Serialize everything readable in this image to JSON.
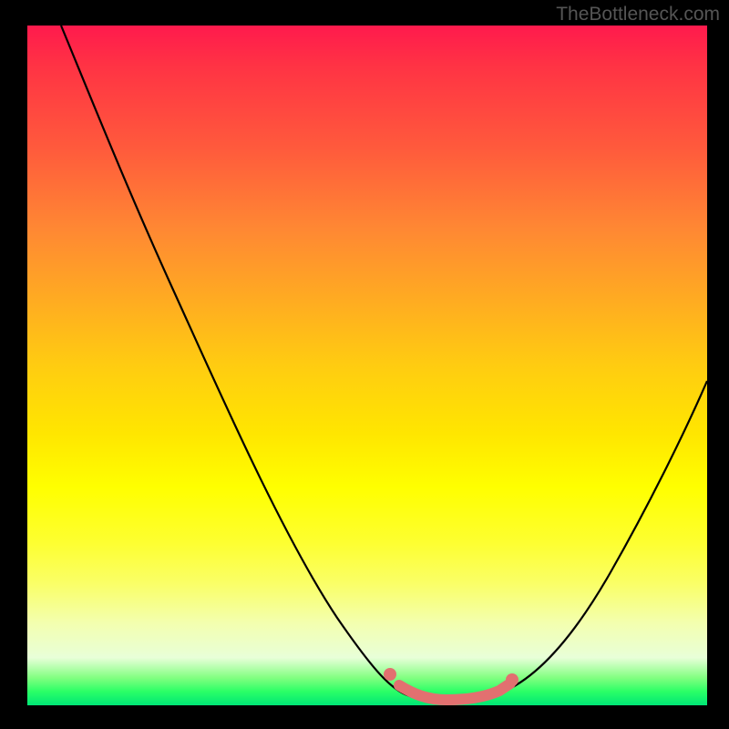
{
  "watermark": "TheBottleneck.com",
  "chart_data": {
    "type": "line",
    "title": "",
    "xlabel": "",
    "ylabel": "",
    "xlim": [
      0,
      100
    ],
    "ylim": [
      0,
      100
    ],
    "series": [
      {
        "name": "bottleneck-curve",
        "color": "#000000",
        "points": [
          {
            "x": 5,
            "y": 100
          },
          {
            "x": 12,
            "y": 84
          },
          {
            "x": 20,
            "y": 66
          },
          {
            "x": 28,
            "y": 48
          },
          {
            "x": 36,
            "y": 31
          },
          {
            "x": 44,
            "y": 16
          },
          {
            "x": 50,
            "y": 7
          },
          {
            "x": 54,
            "y": 3
          },
          {
            "x": 58,
            "y": 1
          },
          {
            "x": 64,
            "y": 1
          },
          {
            "x": 70,
            "y": 2
          },
          {
            "x": 76,
            "y": 8
          },
          {
            "x": 82,
            "y": 18
          },
          {
            "x": 88,
            "y": 30
          },
          {
            "x": 94,
            "y": 42
          },
          {
            "x": 100,
            "y": 55
          }
        ]
      },
      {
        "name": "highlight-segment",
        "color": "#e27070",
        "points": [
          {
            "x": 54,
            "y": 3.5
          },
          {
            "x": 56,
            "y": 2
          },
          {
            "x": 60,
            "y": 1
          },
          {
            "x": 64,
            "y": 1
          },
          {
            "x": 68,
            "y": 1.5
          },
          {
            "x": 71,
            "y": 3
          }
        ]
      }
    ],
    "highlight_dots": [
      {
        "x": 53,
        "y": 4.5,
        "color": "#e27070"
      },
      {
        "x": 71,
        "y": 3.5,
        "color": "#e27070"
      }
    ],
    "gradient_stops": [
      {
        "pos": 0,
        "color": "#ff1a4d"
      },
      {
        "pos": 50,
        "color": "#ffe600"
      },
      {
        "pos": 100,
        "color": "#00e676"
      }
    ]
  }
}
